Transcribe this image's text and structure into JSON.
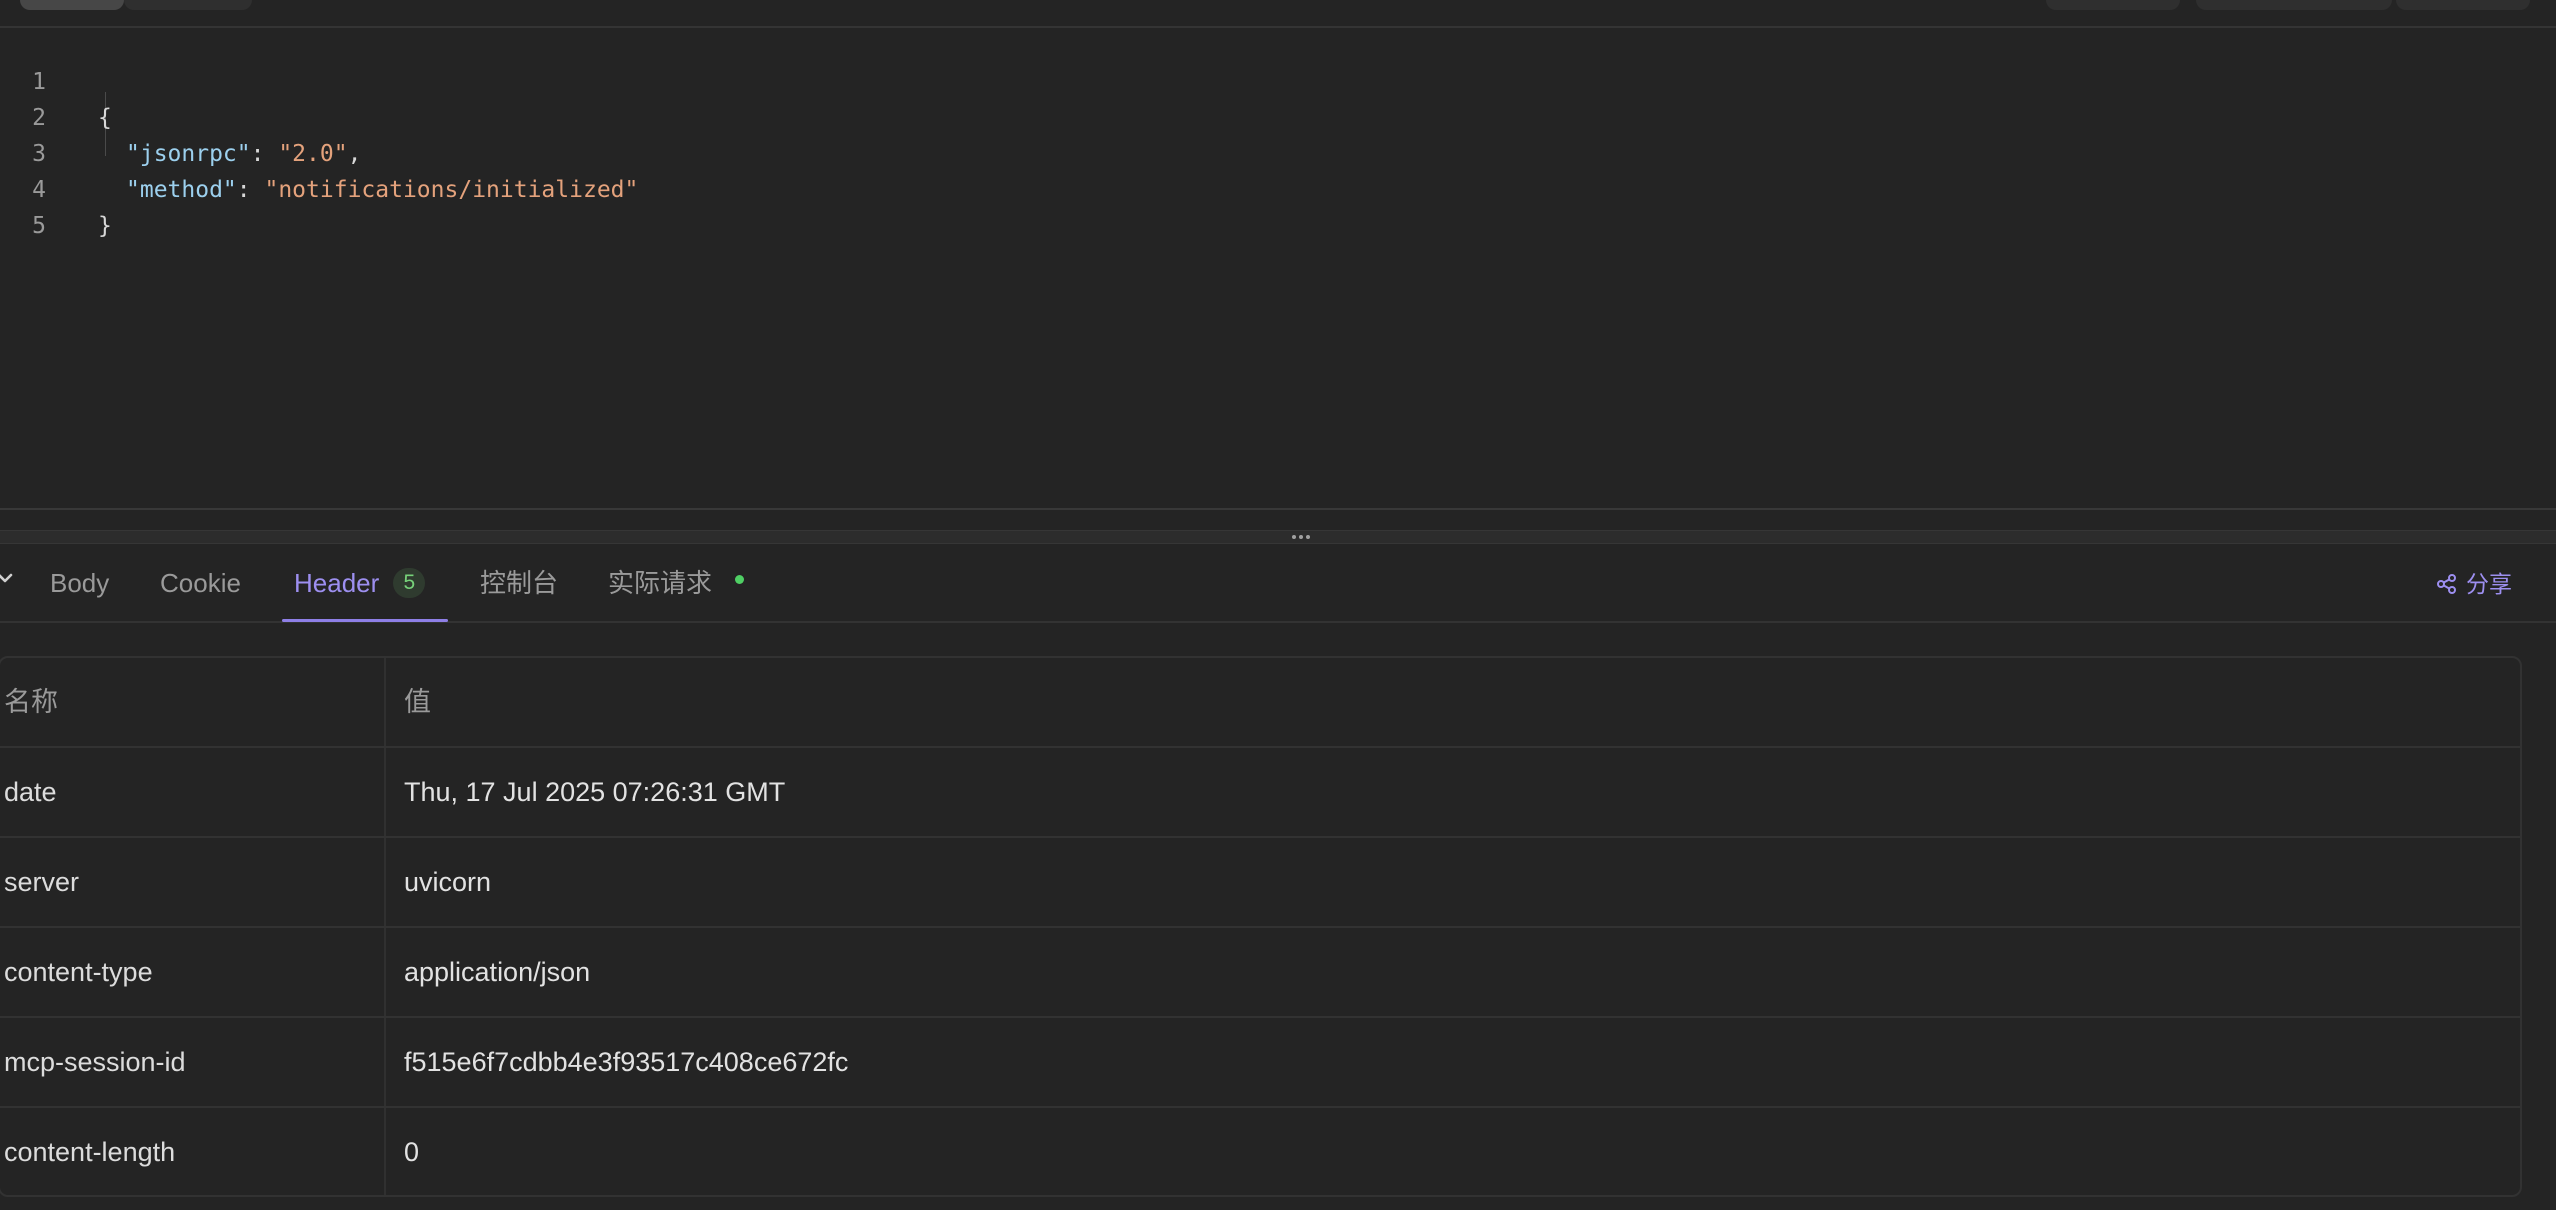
{
  "editor": {
    "lines": [
      {
        "number": "1",
        "text": "{"
      },
      {
        "number": "2",
        "key": "\"jsonrpc\"",
        "value": "\"2.0\"",
        "trail": ","
      },
      {
        "number": "3",
        "key": "\"method\"",
        "value": "\"notifications/initialized\"",
        "trail": ""
      },
      {
        "number": "4",
        "text": "}"
      },
      {
        "number": "5",
        "text": ""
      }
    ]
  },
  "response_tabs": {
    "body": "Body",
    "cookie": "Cookie",
    "header": "Header",
    "header_count": "5",
    "console": "控制台",
    "actual_request": "实际请求",
    "active": "Header"
  },
  "share": {
    "label": "分享"
  },
  "headers_table": {
    "columns": {
      "name": "名称",
      "value": "值"
    },
    "rows": [
      {
        "name": "date",
        "value": "Thu, 17 Jul 2025 07:26:31 GMT"
      },
      {
        "name": "server",
        "value": "uvicorn"
      },
      {
        "name": "content-type",
        "value": "application/json"
      },
      {
        "name": "mcp-session-id",
        "value": "f515e6f7cdbb4e3f93517c408ce672fc"
      },
      {
        "name": "content-length",
        "value": "0"
      }
    ]
  },
  "colors": {
    "accent": "#9d8ff0",
    "badge_green": "#77d27a",
    "status_dot": "#4fcf64",
    "json_key": "#9cd0ee",
    "json_string": "#e4a27c"
  }
}
